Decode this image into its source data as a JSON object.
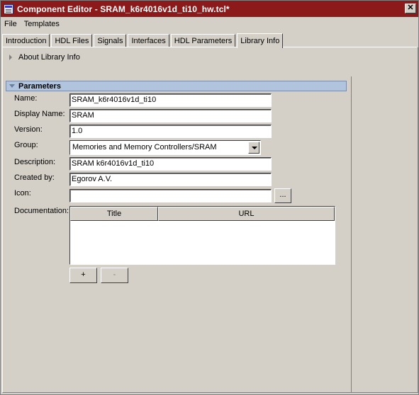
{
  "window": {
    "title": "Component Editor - SRAM_k6r4016v1d_ti10_hw.tcl*",
    "close_glyph": "✕"
  },
  "menu": [
    "File",
    "Templates"
  ],
  "tabs": [
    {
      "label": "Introduction",
      "active": false
    },
    {
      "label": "HDL Files",
      "active": false
    },
    {
      "label": "Signals",
      "active": false
    },
    {
      "label": "Interfaces",
      "active": false
    },
    {
      "label": "HDL Parameters",
      "active": false
    },
    {
      "label": "Library Info",
      "active": true
    }
  ],
  "about": {
    "label": "About Library Info",
    "expanded": false
  },
  "parameters": {
    "header": "Parameters",
    "expanded": true,
    "name": {
      "label": "Name:",
      "value": "SRAM_k6r4016v1d_ti10"
    },
    "display_name": {
      "label": "Display Name:",
      "value": "SRAM"
    },
    "version": {
      "label": "Version:",
      "value": "1.0"
    },
    "group": {
      "label": "Group:",
      "value": "Memories and Memory Controllers/SRAM"
    },
    "description": {
      "label": "Description:",
      "value": "SRAM k6r4016v1d_ti10"
    },
    "created_by": {
      "label": "Created by:",
      "value": "Egorov A.V."
    },
    "icon": {
      "label": "Icon:",
      "value": "",
      "browse_label": "..."
    },
    "documentation": {
      "label": "Documentation:",
      "columns": [
        "Title",
        "URL"
      ],
      "rows": [],
      "add_label": "+",
      "remove_label": "-"
    }
  },
  "colors": {
    "titlebar": "#8c1a1a",
    "section_header": "#b0c4de",
    "background": "#d4d0c8"
  }
}
